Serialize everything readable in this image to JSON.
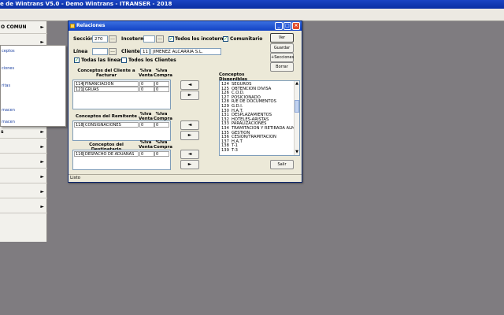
{
  "app": {
    "title": "e de Wintrans V5.0 - Demo Wintrans - ITRANSER - 2018"
  },
  "left_menu": {
    "items": [
      {
        "label": "O COMUN",
        "arrow": "►"
      },
      {
        "label": "",
        "arrow": "►"
      },
      {
        "label": "",
        "arrow": "►"
      },
      {
        "label": "",
        "arrow": "►"
      },
      {
        "label": "",
        "arrow": "►"
      },
      {
        "label": "",
        "arrow": "►"
      },
      {
        "label": "",
        "arrow": "►"
      },
      {
        "label": "s",
        "arrow": "►"
      },
      {
        "label": "",
        "arrow": "►"
      },
      {
        "label": "",
        "arrow": "►"
      },
      {
        "label": "",
        "arrow": "►"
      },
      {
        "label": "",
        "arrow": "►"
      },
      {
        "label": "",
        "arrow": "►"
      }
    ]
  },
  "submenu": {
    "items": [
      "ceptos",
      "ciones",
      "ritas",
      "macen",
      "macen"
    ]
  },
  "dialog": {
    "title": "Relaciones",
    "close_glyph": "×",
    "seccion_label": "Sección",
    "seccion_value": "270",
    "incoterm_label": "Incoterm",
    "incoterm_value": "",
    "todos_incoterms_label": "Todos los incoterms",
    "comunitario_label": "Comunitario",
    "linea_label": "Línea",
    "linea_value": "",
    "cliente_label": "Cliente",
    "cliente_code": "11",
    "cliente_name": "JIMENEZ ALCARRIA S.L.",
    "todas_lineas_label": "Todas las líneas",
    "todos_clientes_label": "Todos los Clientes",
    "ellipsis": "...",
    "check_mark": "✓",
    "buttons": {
      "ver": "Ver",
      "guardar": "Guardar",
      "secciones": "+Secciones",
      "borrar": "Borrar",
      "salir": "Salir"
    },
    "arrows": {
      "left": "◄",
      "right": "►"
    },
    "col_iva_venta": "%Iva Venta",
    "col_iva_compra": "%Iva Compra",
    "cliente_group": {
      "title": "Conceptos del Cliente a Facturar",
      "rows": [
        {
          "code": "114",
          "name": "FINANCIACION",
          "venta": "0",
          "compra": "0"
        },
        {
          "code": "121",
          "name": "GRUAS",
          "venta": "0",
          "compra": "0"
        }
      ]
    },
    "remitente_group": {
      "title": "Conceptos del Remitente",
      "rows": [
        {
          "code": "118",
          "name": "CONSIGNACIONES",
          "venta": "0",
          "compra": "0"
        }
      ]
    },
    "destinatario_group": {
      "title": "Conceptos del Destinatario",
      "rows": [
        {
          "code": "116",
          "name": "DESPACHO DE ADUANAS",
          "venta": "0",
          "compra": "0"
        }
      ]
    },
    "disponibles": {
      "title": "Conceptos Disponibles",
      "items": [
        {
          "code": "124",
          "name": "SEGUROS"
        },
        {
          "code": "125",
          "name": "OBTENCION DIVISA"
        },
        {
          "code": "126",
          "name": "C.O.D."
        },
        {
          "code": "127",
          "name": "POSICIONADO"
        },
        {
          "code": "128",
          "name": "R/E DE DOCUMENTOS"
        },
        {
          "code": "129",
          "name": "G.D.I."
        },
        {
          "code": "130",
          "name": "H.A.T."
        },
        {
          "code": "131",
          "name": "DESPLAZAMIENTOS"
        },
        {
          "code": "132",
          "name": "HOTELES-ARISTAS"
        },
        {
          "code": "133",
          "name": "PARALIZACIONES"
        },
        {
          "code": "134",
          "name": "TRAMITACION Y RETIRADA ALM"
        },
        {
          "code": "135",
          "name": "GESTION"
        },
        {
          "code": "136",
          "name": "CESION/TRAMITACION"
        },
        {
          "code": "137",
          "name": "H.A.T"
        },
        {
          "code": "138",
          "name": "T-1"
        },
        {
          "code": "139",
          "name": "T-3"
        }
      ]
    },
    "status": "Listo"
  }
}
